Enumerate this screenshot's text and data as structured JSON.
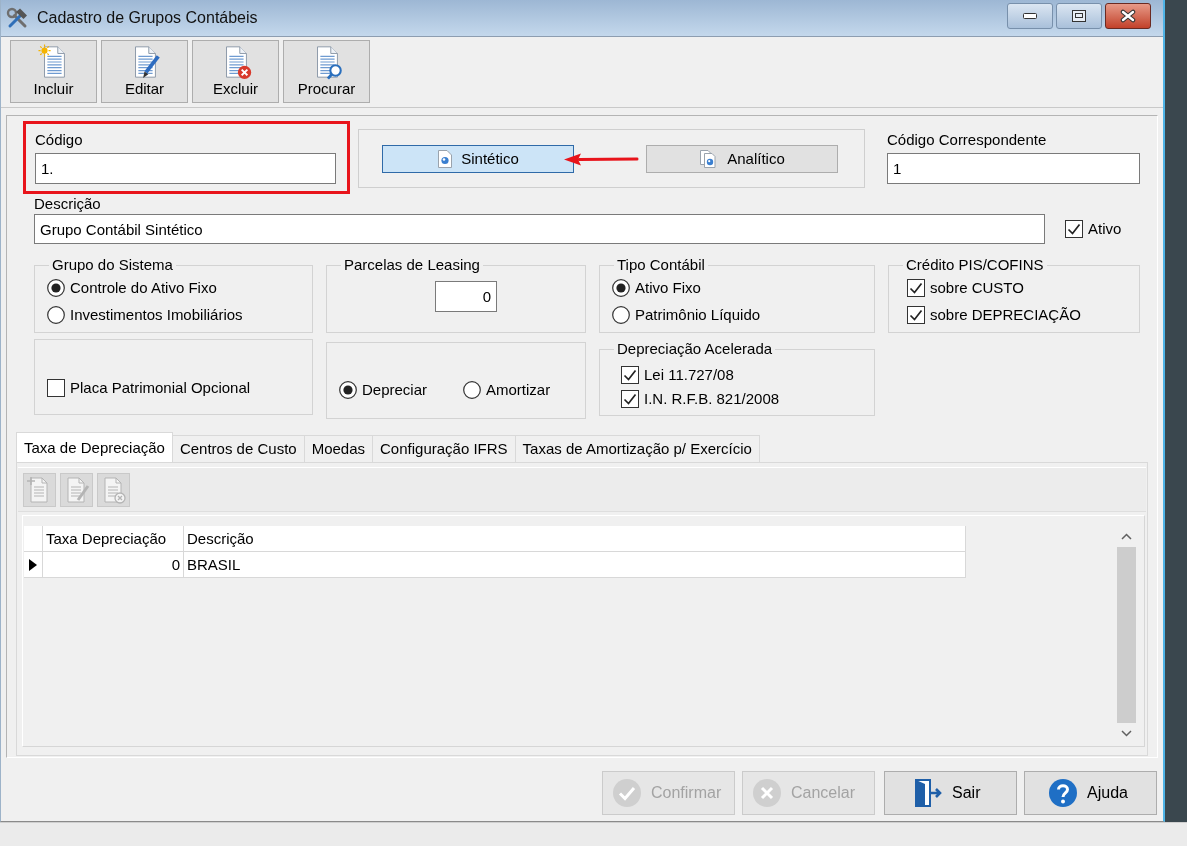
{
  "window": {
    "title": "Cadastro de Grupos Contábeis"
  },
  "toolbar": [
    {
      "label": "Incluir"
    },
    {
      "label": "Editar"
    },
    {
      "label": "Excluir"
    },
    {
      "label": "Procurar"
    }
  ],
  "codigo": {
    "label": "Código",
    "value": "1.",
    "highlighted": true
  },
  "tipo_buttons": [
    {
      "label": "Sintético",
      "selected": true,
      "arrow": true
    },
    {
      "label": "Analítico",
      "selected": false,
      "arrow": false
    }
  ],
  "codigo_correspondente": {
    "label": "Código Correspondente",
    "value": "1"
  },
  "descricao": {
    "label": "Descrição",
    "value": "Grupo Contábil Sintético"
  },
  "ativo": {
    "label": "Ativo",
    "checked": true
  },
  "grupo_do_sistema": {
    "title": "Grupo do Sistema",
    "options": [
      {
        "label": "Controle do Ativo Fixo",
        "selected": true
      },
      {
        "label": "Investimentos Imobiliários",
        "selected": false
      }
    ]
  },
  "parcelas_de_leasing": {
    "title": "Parcelas de Leasing",
    "value": "0"
  },
  "tipo_contabil": {
    "title": "Tipo Contábil",
    "options": [
      {
        "label": "Ativo Fixo",
        "selected": true
      },
      {
        "label": "Patrimônio Líquido",
        "selected": false
      }
    ]
  },
  "credito_pis_cofins": {
    "title": "Crédito PIS/COFINS",
    "options": [
      {
        "label": "sobre CUSTO",
        "checked": true
      },
      {
        "label": "sobre DEPRECIAÇÃO",
        "checked": true
      }
    ]
  },
  "placa_patrimonial": {
    "label": "Placa Patrimonial Opcional",
    "checked": false
  },
  "modo": {
    "options": [
      {
        "label": "Depreciar",
        "selected": true
      },
      {
        "label": "Amortizar",
        "selected": false
      }
    ]
  },
  "depreciacao_acelerada": {
    "title": "Depreciação Acelerada",
    "options": [
      {
        "label": "Lei 11.727/08",
        "checked": true
      },
      {
        "label": "I.N. R.F.B. 821/2008",
        "checked": true
      }
    ]
  },
  "tabs": [
    {
      "label": "Taxa de Depreciação",
      "selected": true
    },
    {
      "label": "Centros de Custo",
      "selected": false
    },
    {
      "label": "Moedas",
      "selected": false
    },
    {
      "label": "Configuração IFRS",
      "selected": false
    },
    {
      "label": "Taxas de Amortização p/ Exercício",
      "selected": false
    }
  ],
  "tab_toolbar": [
    {
      "disabled": true
    },
    {
      "disabled": true
    },
    {
      "disabled": true
    }
  ],
  "grid": {
    "columns": [
      "Taxa Depreciação",
      "Descrição"
    ],
    "rows": [
      {
        "cells": [
          "0",
          "BRASIL"
        ],
        "selected": true
      }
    ]
  },
  "footer_buttons": [
    {
      "label": "Confirmar",
      "disabled": true
    },
    {
      "label": "Cancelar",
      "disabled": true
    },
    {
      "label": "Sair",
      "disabled": false
    },
    {
      "label": "Ajuda",
      "disabled": false
    }
  ]
}
